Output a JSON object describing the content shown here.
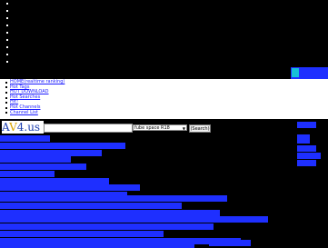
{
  "top_links": [
    "",
    "",
    "",
    "",
    "",
    "",
    "",
    "",
    ""
  ],
  "banner": {
    "text": ""
  },
  "menu": [
    "HOME(realtime ranking)",
    "Hot Tags",
    "HOT DOWNLOAD",
    "Hot Searches",
    "Hit!",
    "Hot Channels",
    "Channel List"
  ],
  "search": {
    "logo_a": "A",
    "logo_v": "V",
    "logo_rest": "4.us",
    "input_value": "",
    "select_value": "fube space R18",
    "button_label": "(Search)"
  },
  "sidebar": {
    "label": ""
  },
  "result_rows": [
    "",
    "",
    "",
    "",
    "",
    "",
    "",
    "",
    "",
    "",
    "",
    "",
    "",
    "",
    "",
    "",
    "",
    ""
  ],
  "colors": {
    "background": "#000000",
    "link_bg": "#1e2fff",
    "link": "#1a1aff",
    "accent": "#16c0d8"
  }
}
